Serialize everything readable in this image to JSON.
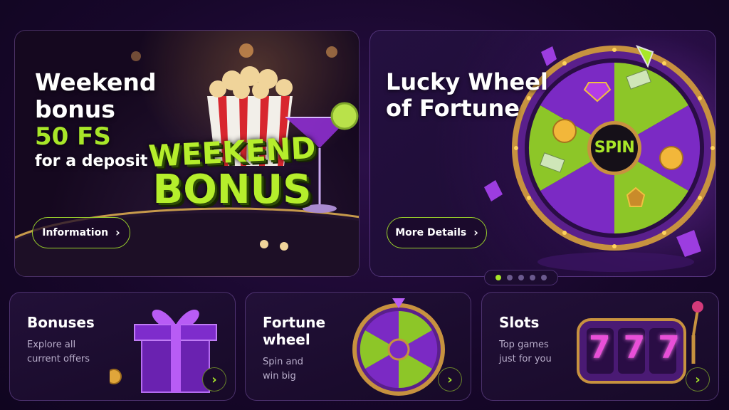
{
  "hero1": {
    "title_line1": "Weekend",
    "title_line2": "bonus",
    "highlight": "50 FS",
    "subline": "for a deposit",
    "banner_line1": "WEEKEND",
    "banner_line2": "BONUS",
    "button_label": "Information"
  },
  "hero2": {
    "title_line1": "Lucky Wheel",
    "title_line2": "of Fortune",
    "spin_label": "SPIN",
    "button_label": "More Details"
  },
  "carousel": {
    "total": 5,
    "active": 1
  },
  "cards": {
    "bonuses": {
      "title": "Bonuses",
      "sub1": "Explore all",
      "sub2": "current offers"
    },
    "wheel": {
      "title1": "Fortune",
      "title2": "wheel",
      "sub1": "Spin and",
      "sub2": "win big"
    },
    "slots": {
      "title": "Slots",
      "sub1": "Top games",
      "sub2": "just for you",
      "reels": "777"
    }
  },
  "colors": {
    "accent": "#a8e629",
    "purple": "#7a2bc2",
    "background": "#17072a"
  },
  "icons": {
    "chevron": "chevron-right-icon"
  }
}
